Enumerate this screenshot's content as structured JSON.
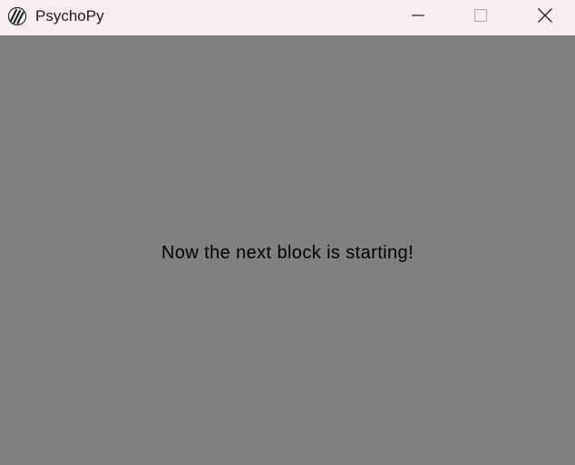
{
  "window": {
    "title": "PsychoPy",
    "app_icon": "psychopy-logo-icon",
    "controls": {
      "minimize_icon": "minimize-icon",
      "maximize_icon": "maximize-icon",
      "close_icon": "close-icon"
    },
    "titlebar_color": "#f8eef2",
    "background_color": "#808080"
  },
  "stage": {
    "message": "Now the next block is starting!",
    "text_color": "#000000"
  }
}
